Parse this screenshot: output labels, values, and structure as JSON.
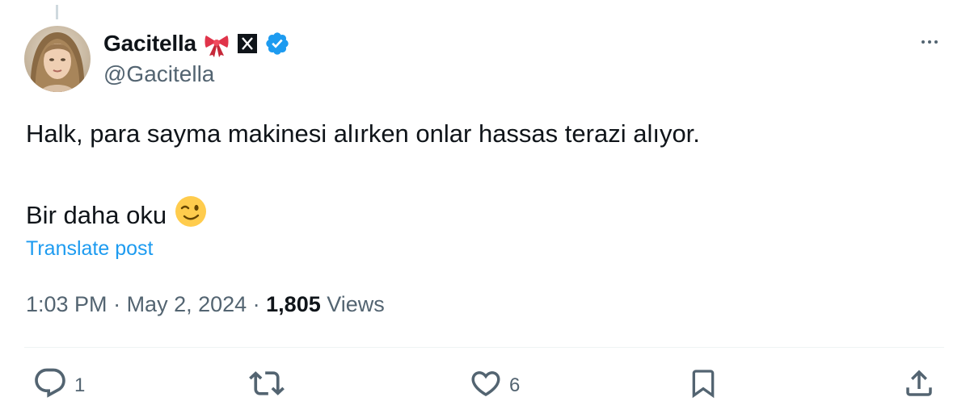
{
  "author": {
    "display_name": "Gacitella",
    "handle": "@Gacitella",
    "badges": [
      "ribbon-emoji",
      "x-affiliate-icon",
      "verified-badge-icon"
    ],
    "verified_color": "#1d9bf0"
  },
  "post": {
    "line1": "Halk, para sayma makinesi alırken onlar hassas terazi alıyor.",
    "line2": "Bir daha oku",
    "line2_emoji": "😉",
    "translate": "Translate post"
  },
  "meta": {
    "time": "1:03 PM",
    "sep1": " · ",
    "date": "May 2, 2024",
    "sep2": " · ",
    "views_count": "1,805",
    "views_label": " Views"
  },
  "actions": {
    "replies": "1",
    "reposts": "",
    "likes": "6"
  },
  "colors": {
    "accent": "#1d9bf0",
    "text": "#0f1419",
    "muted": "#536471"
  }
}
